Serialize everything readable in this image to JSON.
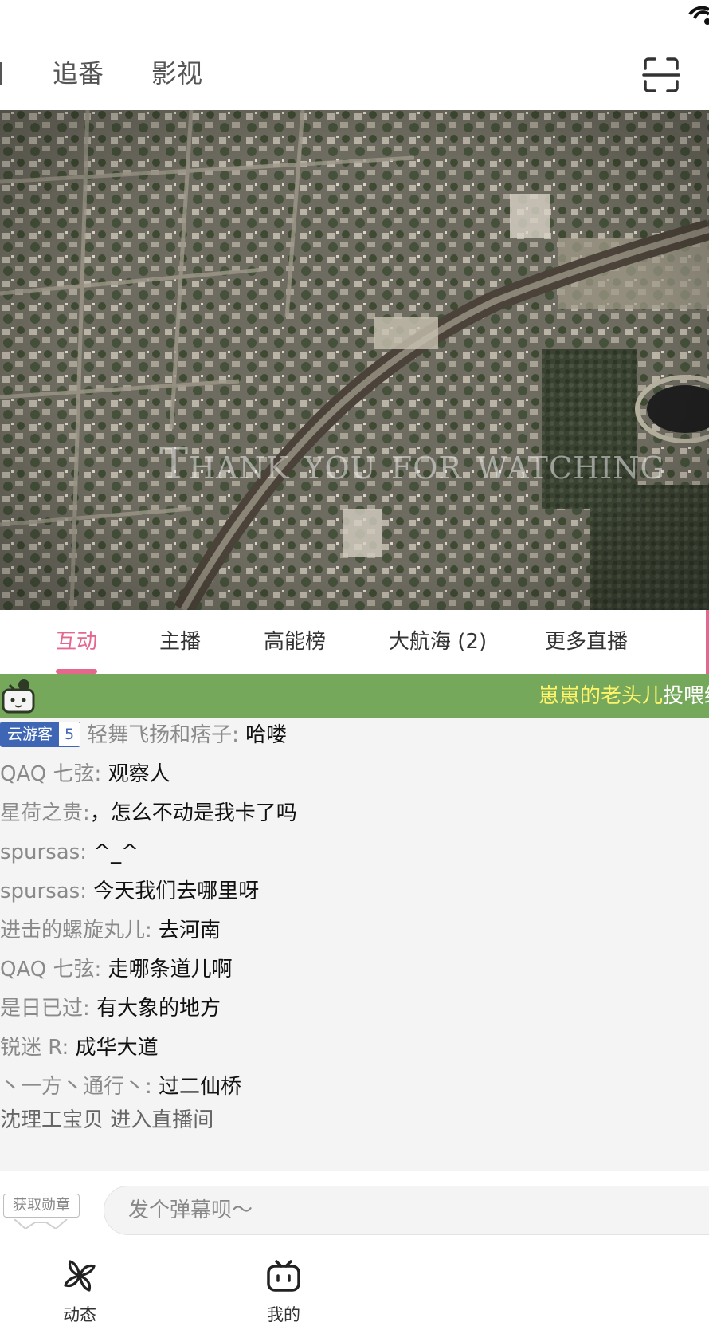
{
  "status_bar": {
    "icons": [
      "wifi-icon"
    ]
  },
  "top_nav": {
    "tabs": [
      {
        "label": "追番"
      },
      {
        "label": "影视"
      }
    ],
    "right_icon": "scan-icon"
  },
  "video": {
    "caption": "Thank you for watching"
  },
  "sub_tabs": [
    {
      "label": "互动",
      "active": true
    },
    {
      "label": "主播"
    },
    {
      "label": "高能榜"
    },
    {
      "label": "大航海 (2)"
    },
    {
      "label": "更多直播"
    }
  ],
  "gift_banner": {
    "icon": "tv-mascot-icon",
    "user": "崽崽的老头儿",
    "action": "投喂给"
  },
  "chat": {
    "messages": [
      {
        "medal": {
          "name": "云游客",
          "level": "5"
        },
        "user": "轻舞飞扬和痞子:",
        "text": "哈喽"
      },
      {
        "user": "QAQ 七弦:",
        "text": "观察人"
      },
      {
        "user": "星荷之贵:",
        "text": "，怎么不动是我卡了吗"
      },
      {
        "user": "spursas:",
        "text": "^_^"
      },
      {
        "user": "spursas:",
        "text": "今天我们去哪里呀"
      },
      {
        "user": "进击的螺旋丸儿:",
        "text": "去河南"
      },
      {
        "user": "QAQ 七弦:",
        "text": "走哪条道儿啊"
      },
      {
        "user": "是日已过:",
        "text": "有大象的地方"
      },
      {
        "user": "锐迷 R:",
        "text": "成华大道"
      },
      {
        "user": "丶一方丶通行丶:",
        "text": "过二仙桥"
      }
    ],
    "enter_notice": {
      "user": "沈理工宝贝",
      "text": "进入直播间"
    }
  },
  "input_bar": {
    "badge_label": "获取勋章",
    "placeholder": "发个弹幕呗～"
  },
  "bottom_nav": [
    {
      "label": "动态",
      "icon": "pinwheel-icon"
    },
    {
      "label": "我的",
      "icon": "tv-icon"
    }
  ],
  "colors": {
    "accent": "#e5678e",
    "banner": "#75a85a",
    "medal": "#3f66b5",
    "gift_user": "#fff36a"
  }
}
